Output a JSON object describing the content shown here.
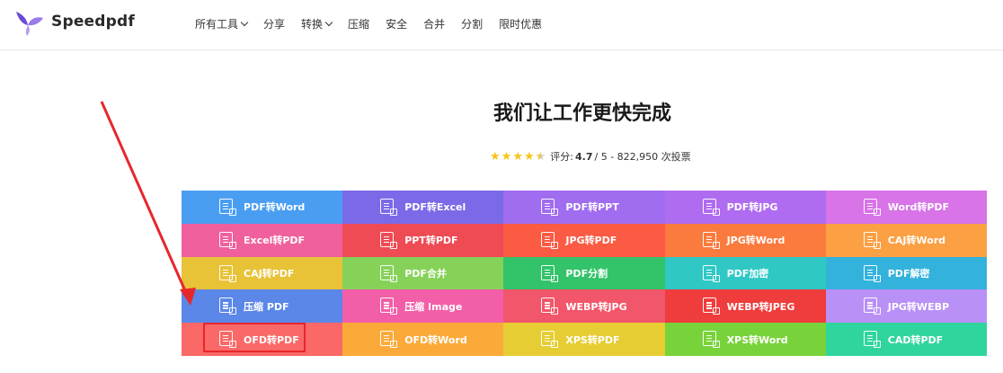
{
  "header": {
    "brand": "Speedpdf",
    "nav": [
      {
        "label": "所有工具",
        "dropdown": true
      },
      {
        "label": "分享",
        "dropdown": false
      },
      {
        "label": "转换",
        "dropdown": true
      },
      {
        "label": "压缩",
        "dropdown": false
      },
      {
        "label": "安全",
        "dropdown": false
      },
      {
        "label": "合并",
        "dropdown": false
      },
      {
        "label": "分割",
        "dropdown": false
      },
      {
        "label": "限时优惠",
        "dropdown": false
      }
    ]
  },
  "hero": {
    "headline": "我们让工作更快完成",
    "rating": {
      "label": "评分:",
      "score": "4.7",
      "rest": "/ 5 - 822,950 次投票",
      "stars_value": 4.5
    }
  },
  "tools": [
    {
      "label": "PDF转Word",
      "color": "#4a9ef2"
    },
    {
      "label": "PDF转Excel",
      "color": "#7a6ae8"
    },
    {
      "label": "PDF转PPT",
      "color": "#a06cf0"
    },
    {
      "label": "PDF转JPG",
      "color": "#b06cf0"
    },
    {
      "label": "Word转PDF",
      "color": "#d873e8"
    },
    {
      "label": "Excel转PDF",
      "color": "#f0609c"
    },
    {
      "label": "PPT转PDF",
      "color": "#ee4b55"
    },
    {
      "label": "JPG转PDF",
      "color": "#fb5a43"
    },
    {
      "label": "JPG转Word",
      "color": "#fb7a3e"
    },
    {
      "label": "CAJ转Word",
      "color": "#fba043"
    },
    {
      "label": "CAJ转PDF",
      "color": "#e8c237"
    },
    {
      "label": "PDF合并",
      "color": "#86d259"
    },
    {
      "label": "PDF分割",
      "color": "#33c36a"
    },
    {
      "label": "PDF加密",
      "color": "#2fc8c5"
    },
    {
      "label": "PDF解密",
      "color": "#33b2dc"
    },
    {
      "label": "压缩 PDF",
      "color": "#5a87e8"
    },
    {
      "label": "压缩 Image",
      "color": "#f25ea8"
    },
    {
      "label": "WEBP转JPG",
      "color": "#f2566a"
    },
    {
      "label": "WEBP转JPEG",
      "color": "#ef3c3c"
    },
    {
      "label": "JPG转WEBP",
      "color": "#b990f5"
    },
    {
      "label": "OFD转PDF",
      "color": "#fa6868"
    },
    {
      "label": "OFD转Word",
      "color": "#fbaa3a"
    },
    {
      "label": "XPS转PDF",
      "color": "#e6cd33"
    },
    {
      "label": "XPS转Word",
      "color": "#78d33a"
    },
    {
      "label": "CAD转PDF",
      "color": "#2fd59d"
    }
  ],
  "annotation": {
    "arrow_color": "#e8262a",
    "highlighted_tool": "OFD转PDF"
  }
}
